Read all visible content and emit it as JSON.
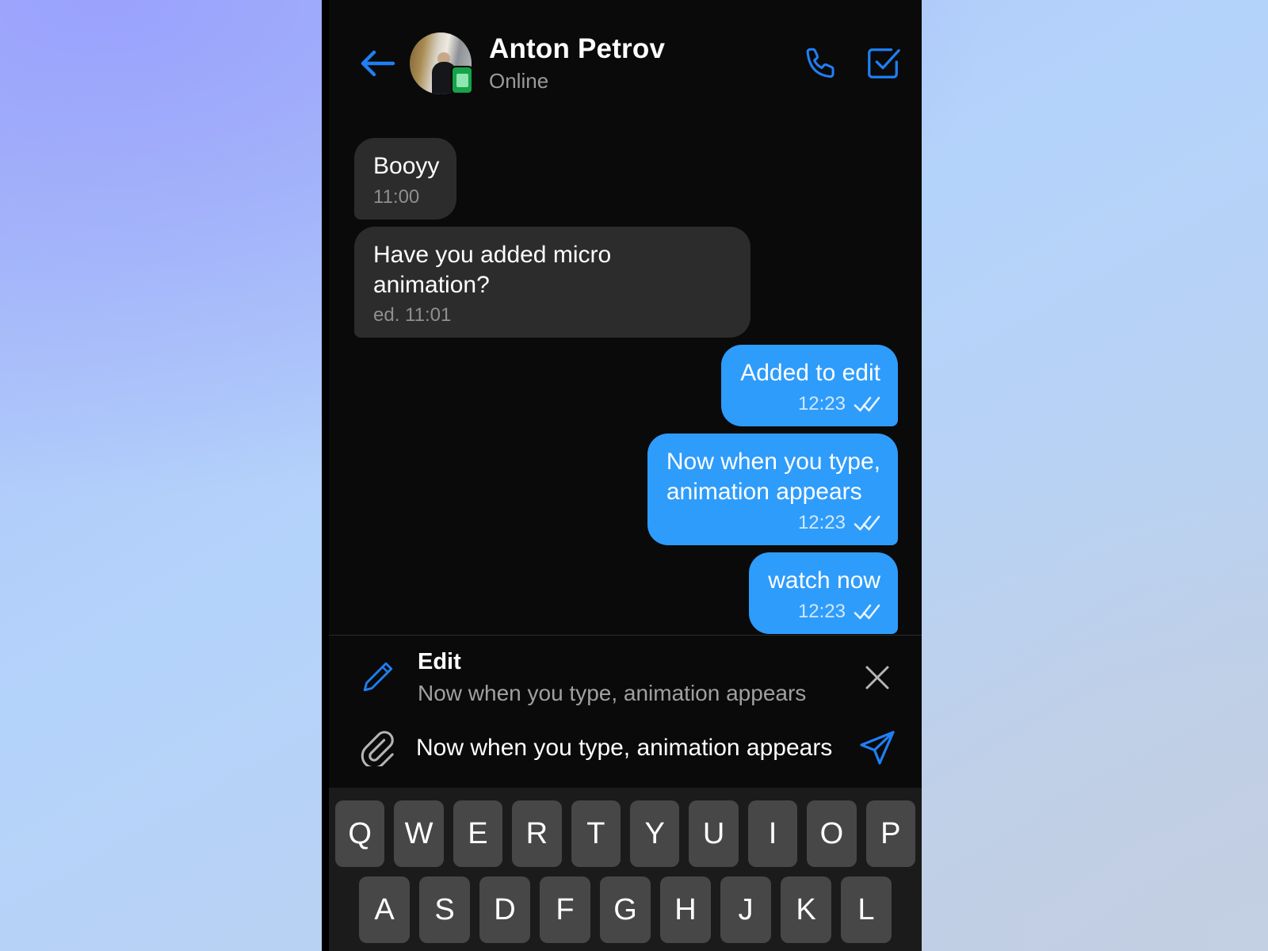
{
  "theme": {
    "bubble_out_color": "#2e9cfb",
    "bubble_in_color": "#2c2c2c",
    "accent_color": "#1f7ff5",
    "chat_background": "#0a0a0a",
    "keyboard_background": "#1b1b1b",
    "key_color": "#474747",
    "online_badge_color": "#16a34a"
  },
  "header": {
    "back_icon": "arrow-left-icon",
    "avatar_alt": "contact-avatar",
    "status_badge": "online-device-badge",
    "contact_name": "Anton Petrov",
    "contact_status": "Online",
    "call_icon": "phone-icon",
    "confirm_icon": "check-square-icon"
  },
  "messages": [
    {
      "direction": "in",
      "text": "Booyy",
      "time": "11:00",
      "edited": false,
      "ticks": ""
    },
    {
      "direction": "in",
      "text": "Have you added micro animation?",
      "time": "ed. 11:01",
      "edited": true,
      "ticks": ""
    },
    {
      "direction": "out",
      "text": "Added to edit",
      "time": "12:23",
      "edited": false,
      "ticks": "double-check-icon"
    },
    {
      "direction": "out",
      "text": "Now when you type,\nanimation appears",
      "time": "12:23",
      "edited": false,
      "ticks": "double-check-icon"
    },
    {
      "direction": "out",
      "text": "watch now",
      "time": "12:23",
      "edited": false,
      "ticks": "double-check-icon"
    }
  ],
  "edit_panel": {
    "icon": "pencil-icon",
    "title": "Edit",
    "preview": "Now when you type, animation appears",
    "close_icon": "close-icon"
  },
  "input_bar": {
    "attach_icon": "paperclip-icon",
    "value": "Now when you type, animation appears",
    "placeholder": "Message",
    "send_icon": "send-plane-icon"
  },
  "keyboard": {
    "rows": [
      [
        "Q",
        "W",
        "E",
        "R",
        "T",
        "Y",
        "U",
        "I",
        "O",
        "P"
      ],
      [
        "A",
        "S",
        "D",
        "F",
        "G",
        "H",
        "J",
        "K",
        "L"
      ]
    ]
  }
}
